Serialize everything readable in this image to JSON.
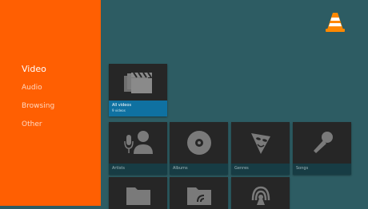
{
  "sidebar": {
    "items": [
      {
        "label": "Video",
        "active": true
      },
      {
        "label": "Audio",
        "active": false
      },
      {
        "label": "Browsing",
        "active": false
      },
      {
        "label": "Other",
        "active": false
      }
    ]
  },
  "logo": {
    "icon": "vlc-cone-icon"
  },
  "cards": {
    "all_videos": {
      "title": "All videos",
      "subtitle": "9 videos",
      "icon": "clapperboard-icon"
    },
    "artists": {
      "label": "Artists",
      "icon": "microphone-person-icon"
    },
    "albums": {
      "label": "Albums",
      "icon": "disc-icon"
    },
    "genres": {
      "label": "Genres",
      "icon": "theater-mask-icon"
    },
    "songs": {
      "label": "Songs",
      "icon": "microphone-icon"
    },
    "folder1": {
      "icon": "folder-icon"
    },
    "folder2": {
      "icon": "network-folder-icon"
    },
    "stream": {
      "icon": "stream-icon"
    }
  },
  "colors": {
    "sidebar": "#ff5f02",
    "background": "#2d5c63",
    "card": "#262626",
    "selected_label": "#0f71a1",
    "label_bg": "#173c44"
  }
}
